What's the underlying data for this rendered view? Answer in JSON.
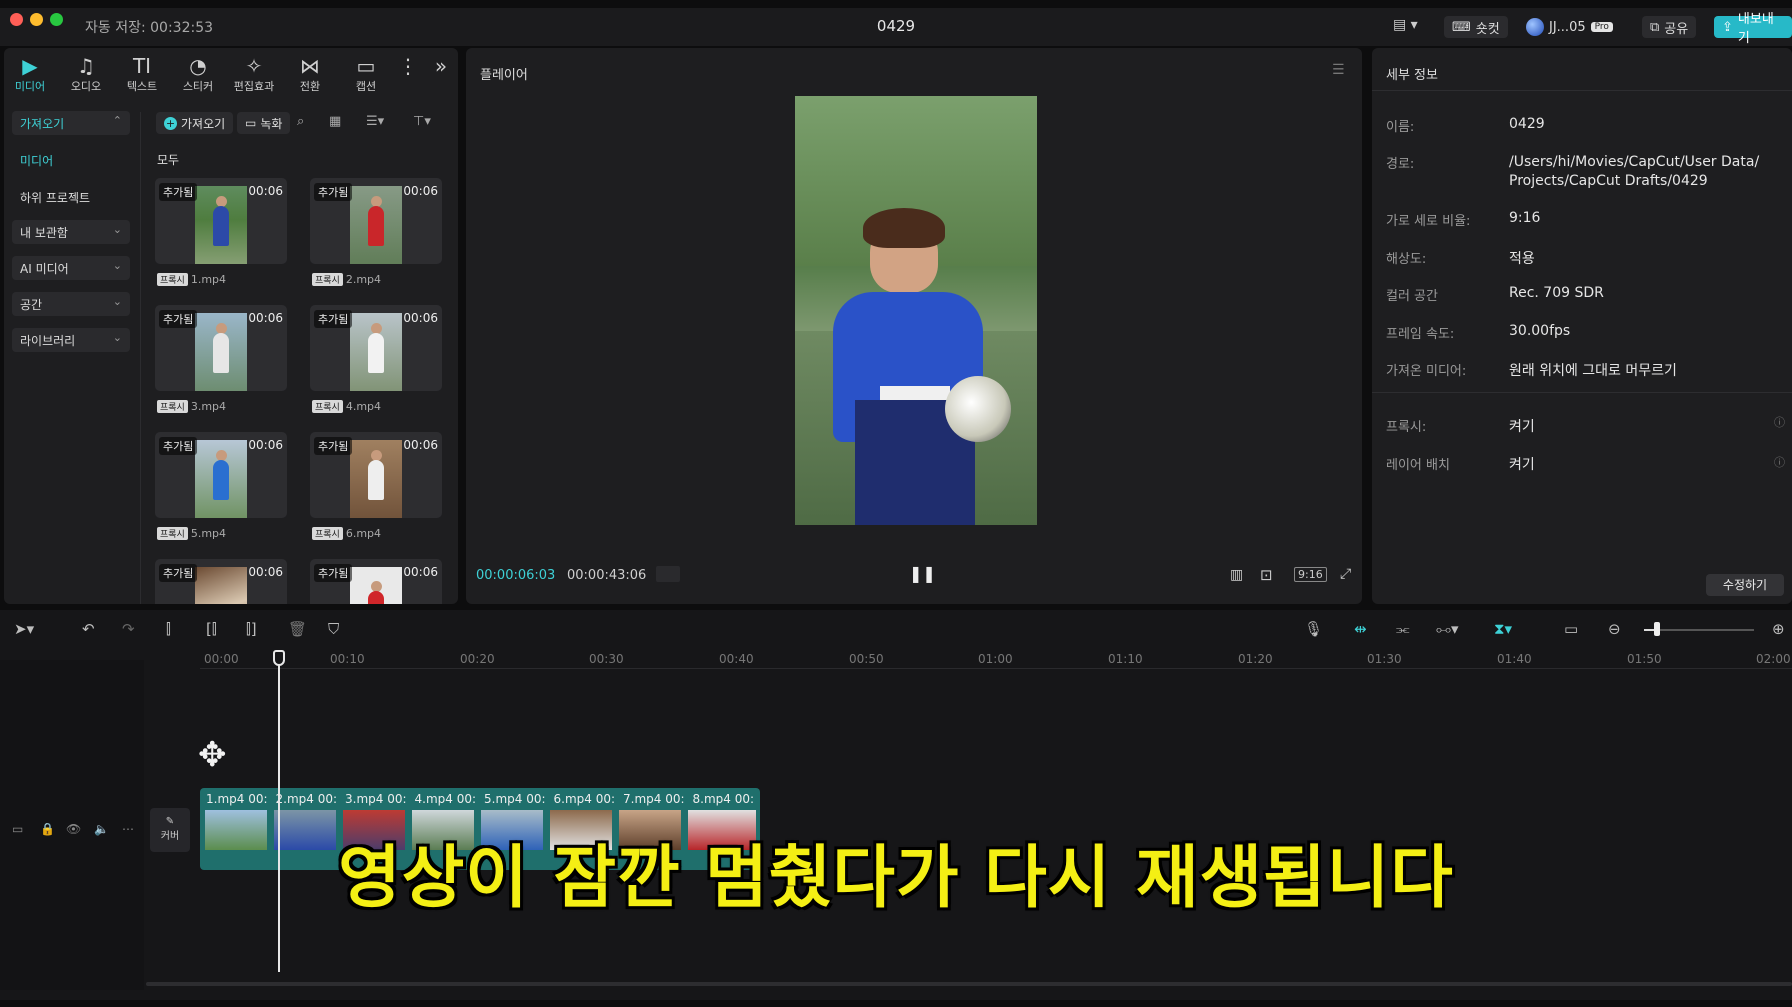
{
  "titlebar": {
    "autosave": "자동 저장: 00:32:53",
    "title": "0429",
    "shortcut": "숏컷",
    "user": "JJ...05",
    "pro_badge": "Pro",
    "share": "공유",
    "export": "내보내기"
  },
  "categories": [
    "미디어",
    "오디오",
    "텍스트",
    "스티커",
    "편집효과",
    "전환",
    "캡션"
  ],
  "sidebar": {
    "import": "가져오기",
    "media": "미디어",
    "subproject": "하위 프로젝트",
    "my_storage": "내 보관함",
    "ai_media": "AI 미디어",
    "space": "공간",
    "library": "라이브러리"
  },
  "media_toolbar": {
    "import": "가져오기",
    "record": "녹화"
  },
  "media_section": "모두",
  "media": [
    {
      "added": "추가됨",
      "duration": "00:06",
      "proxy": "프록시",
      "name": "1.mp4"
    },
    {
      "added": "추가됨",
      "duration": "00:06",
      "proxy": "프록시",
      "name": "2.mp4"
    },
    {
      "added": "추가됨",
      "duration": "00:06",
      "proxy": "프록시",
      "name": "3.mp4"
    },
    {
      "added": "추가됨",
      "duration": "00:06",
      "proxy": "프록시",
      "name": "4.mp4"
    },
    {
      "added": "추가됨",
      "duration": "00:06",
      "proxy": "프록시",
      "name": "5.mp4"
    },
    {
      "added": "추가됨",
      "duration": "00:06",
      "proxy": "프록시",
      "name": "6.mp4"
    },
    {
      "added": "추가됨",
      "duration": "00:06"
    },
    {
      "added": "추가됨",
      "duration": "00:06"
    }
  ],
  "player": {
    "title": "플레이어",
    "current_time": "00:00:06:03",
    "total_time": "00:00:43:06",
    "ratio": "9:16"
  },
  "details": {
    "title": "세부 정보",
    "rows": [
      {
        "label": "이름:",
        "value": "0429"
      },
      {
        "label": "경로:",
        "value": "/Users/hi/Movies/CapCut/User Data/\nProjects/CapCut Drafts/0429"
      },
      {
        "label": "가로 세로 비율:",
        "value": "9:16"
      },
      {
        "label": "해상도:",
        "value": "적용"
      },
      {
        "label": "컬러 공간",
        "value": "Rec. 709 SDR"
      },
      {
        "label": "프레임 속도:",
        "value": "30.00fps"
      },
      {
        "label": "가져온 미디어:",
        "value": "원래 위치에 그대로 머무르기"
      },
      {
        "label": "프록시:",
        "value": "켜기"
      },
      {
        "label": "레이어 배치",
        "value": "켜기"
      }
    ],
    "modify": "수정하기"
  },
  "ruler": [
    "00:00",
    "00:10",
    "00:20",
    "00:30",
    "00:40",
    "00:50",
    "01:00",
    "01:10",
    "01:20",
    "01:30",
    "01:40",
    "01:50",
    "02:00"
  ],
  "clips": [
    "1.mp4",
    "2.mp4",
    "3.mp4",
    "4.mp4",
    "5.mp4",
    "6.mp4",
    "7.mp4",
    "8.mp4"
  ],
  "clip_time_prefix": "00:",
  "cover_label": "커버",
  "subtitle": "영상이 잠깐 멈췄다가 다시 재생됩니다",
  "colors": {
    "accent": "#3ed1d6",
    "subtitle": "#f4ef14",
    "clip": "#1f6f6c"
  }
}
